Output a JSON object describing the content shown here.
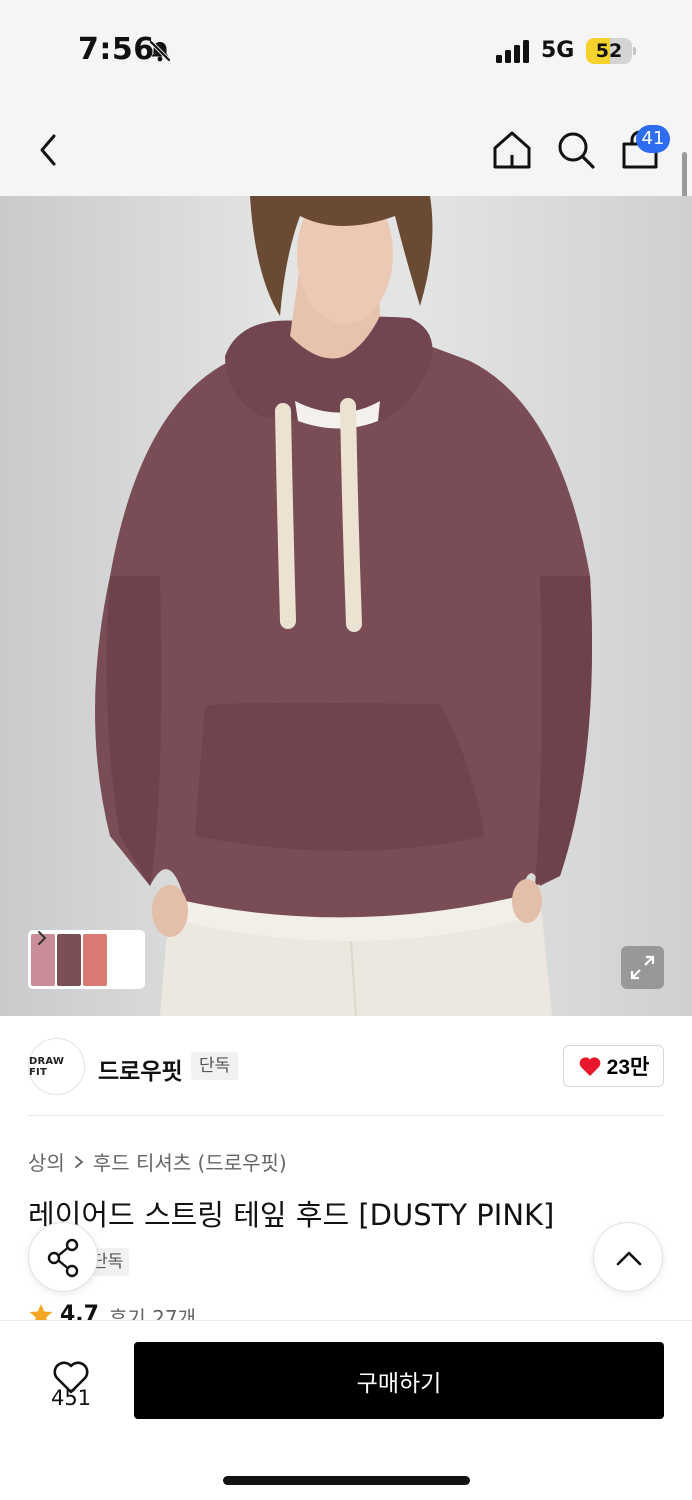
{
  "status_bar": {
    "time": "7:56",
    "network": "5G",
    "battery": "52",
    "battery_level": 0.52,
    "icons": [
      "bell-slash-icon",
      "signal-icon"
    ]
  },
  "nav": {
    "cart_count": "41",
    "icons": [
      "chevron-left-icon",
      "home-icon",
      "search-icon",
      "shopping-bag-icon"
    ]
  },
  "gallery": {
    "icons": [
      "chevron-right-icon",
      "expand-icon"
    ]
  },
  "brand": {
    "logo_text": "DRAW FIT",
    "name": "드로우핏",
    "tag": "단독",
    "likes": "23만"
  },
  "product": {
    "breadcrumb": [
      "상의",
      "후드 티셔츠 (드로우핏)"
    ],
    "title": "레이어드 스트링 테잎 후드 [DUSTY PINK]",
    "tag": "단독",
    "rating": "4.7",
    "reviews": "후기 27개"
  },
  "bottom_bar": {
    "wish_count": "451",
    "buy_label": "구매하기"
  },
  "colors": {
    "accent_blue": "#2f6df0",
    "heart_red": "#e8192c",
    "star_orange": "#f5a623",
    "buy_button": "#000000"
  }
}
